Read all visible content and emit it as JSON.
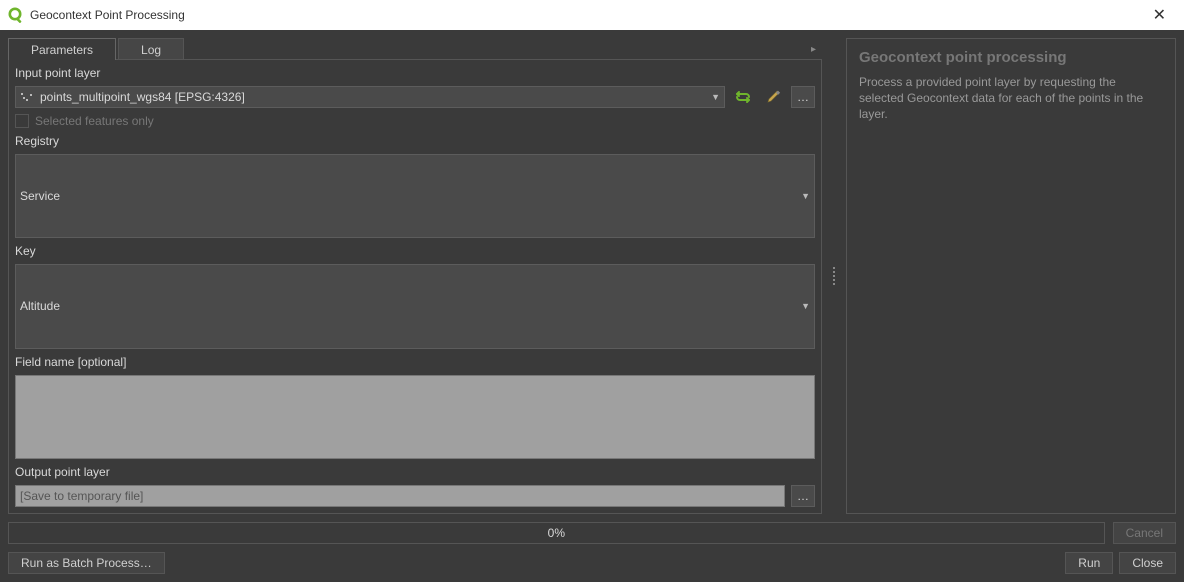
{
  "window": {
    "title": "Geocontext Point Processing"
  },
  "tabs": {
    "parameters": "Parameters",
    "log": "Log"
  },
  "form": {
    "input_label": "Input point layer",
    "input_value": "points_multipoint_wgs84 [EPSG:4326]",
    "selected_only": "Selected features only",
    "registry_label": "Registry",
    "registry_value": "Service",
    "key_label": "Key",
    "key_value": "Altitude",
    "fieldname_label": "Field name [optional]",
    "fieldname_value": "",
    "output_label": "Output point layer",
    "output_placeholder": "[Save to temporary file]"
  },
  "help": {
    "title": "Geocontext point processing",
    "body": "Process a provided point layer by requesting the selected Geocontext data for each of the points in the layer."
  },
  "progress": {
    "text": "0%"
  },
  "buttons": {
    "cancel": "Cancel",
    "batch": "Run as Batch Process…",
    "run": "Run",
    "close": "Close"
  }
}
